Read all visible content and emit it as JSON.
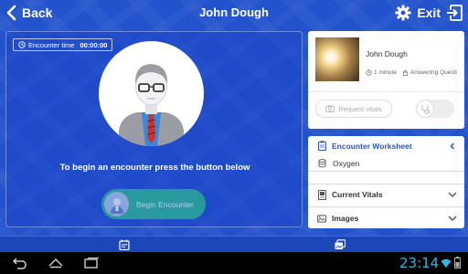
{
  "header": {
    "back_label": "Back",
    "title": "John Dough",
    "exit_label": "Exit"
  },
  "encounter": {
    "timer_label": "Encounter time",
    "timer_value": "00:00:00",
    "prompt": "To begin an encounter press the button below",
    "begin_label": "Begin Encounter"
  },
  "patient_card": {
    "name": "John Dough",
    "duration": "1 minute",
    "status": "Answering Questi",
    "request_vitals_label": "Request vitals"
  },
  "worksheet": {
    "title": "Encounter Worksheet",
    "oxygen_label": "Oxygen",
    "vitals_label": "Current Vitals",
    "images_label": "Images"
  },
  "system": {
    "clock": "23:14"
  },
  "colors": {
    "brand_blue": "#2353cc",
    "accent_green": "#2bb48f",
    "worksheet_title": "#2b56b8",
    "clock_blue": "#33b5e5"
  },
  "icons": {
    "back": "chevron-left-icon",
    "settings": "gear-icon",
    "exit": "exit-door-icon",
    "timer": "clock-icon",
    "worksheet": "clipboard-icon",
    "oxygen": "cylinder-icon",
    "vitals": "monitor-icon",
    "images": "image-icon",
    "tab_calendar": "calendar-icon",
    "tab_gallery": "gallery-icon"
  }
}
